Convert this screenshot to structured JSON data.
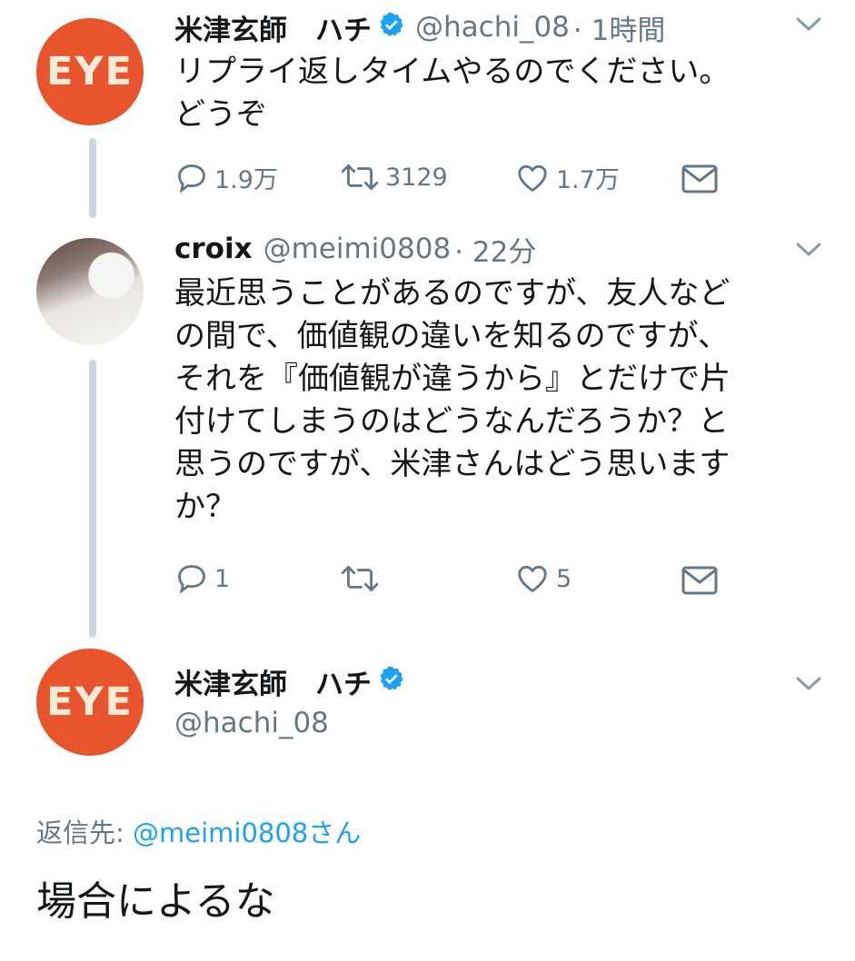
{
  "tweets": [
    {
      "name": "米津玄師　ハチ",
      "verified": true,
      "handle": "@hachi_08",
      "time": "· 1時間",
      "avatar_text": "EYE",
      "text": "リプライ返しタイムやるのでください。\nどうぞ",
      "actions": {
        "reply": "1.9万",
        "retweet": "3129",
        "like": "1.7万"
      }
    },
    {
      "name": "croix",
      "verified": false,
      "handle": "@meimi0808",
      "time": "· 22分",
      "text": "最近思うことがあるのですが、友人など\nの間で、価値観の違いを知るのですが、\nそれを『価値観が違うから』とだけで片\n付けてしまうのはどうなんだろうか？と\n思うのですが、米津さんはどう思います\nか？",
      "actions": {
        "reply": "1",
        "retweet": "",
        "like": "5"
      }
    },
    {
      "name": "米津玄師　ハチ",
      "verified": true,
      "handle": "@hachi_08",
      "avatar_text": "EYE",
      "reply_to_label": "返信先:",
      "reply_to_user": "@meimi0808さん",
      "text": "場合によるな"
    }
  ],
  "colors": {
    "accent": "#1da1f2",
    "avatar_orange": "#e8542b",
    "thread_line": "#ccd6dd",
    "secondary_text": "#657786"
  },
  "icons": [
    "reply-icon",
    "retweet-icon",
    "like-icon",
    "message-icon",
    "verified-badge-icon",
    "chevron-down-icon"
  ]
}
